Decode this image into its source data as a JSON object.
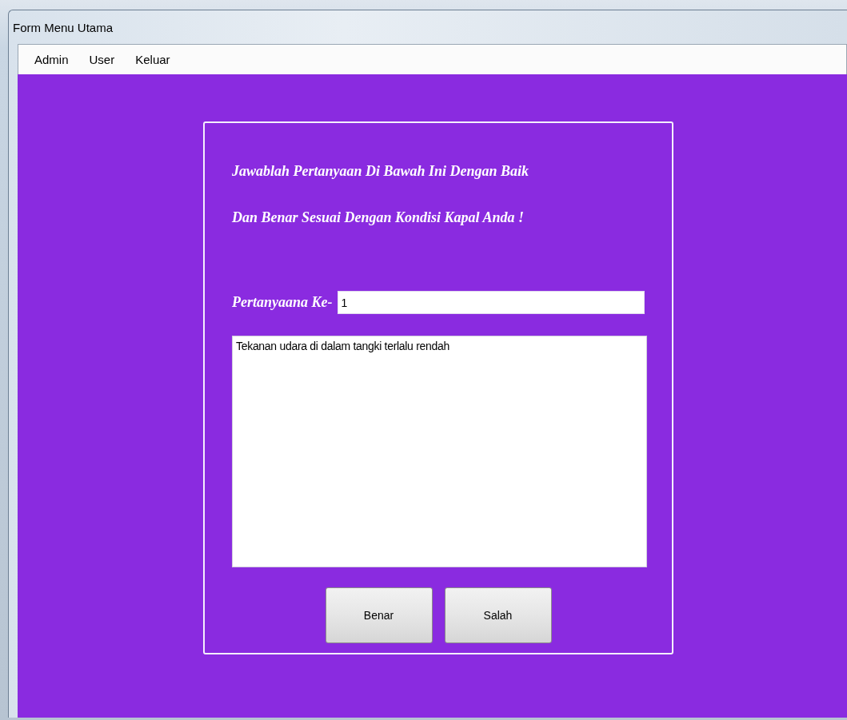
{
  "window": {
    "title": "Form Menu Utama"
  },
  "menu": [
    {
      "label": "Admin"
    },
    {
      "label": "User"
    },
    {
      "label": "Keluar"
    }
  ],
  "instructions": [
    "Jawablah Pertanyaan Di Bawah Ini Dengan Baik",
    "Dan Benar Sesuai Dengan Kondisi Kapal Anda !"
  ],
  "question_number": {
    "label": "Pertanyaana Ke-",
    "value": "1"
  },
  "question_text": {
    "value": "Tekanan udara di dalam tangki terlalu rendah"
  },
  "buttons": [
    {
      "label": "Benar"
    },
    {
      "label": "Salah"
    }
  ]
}
